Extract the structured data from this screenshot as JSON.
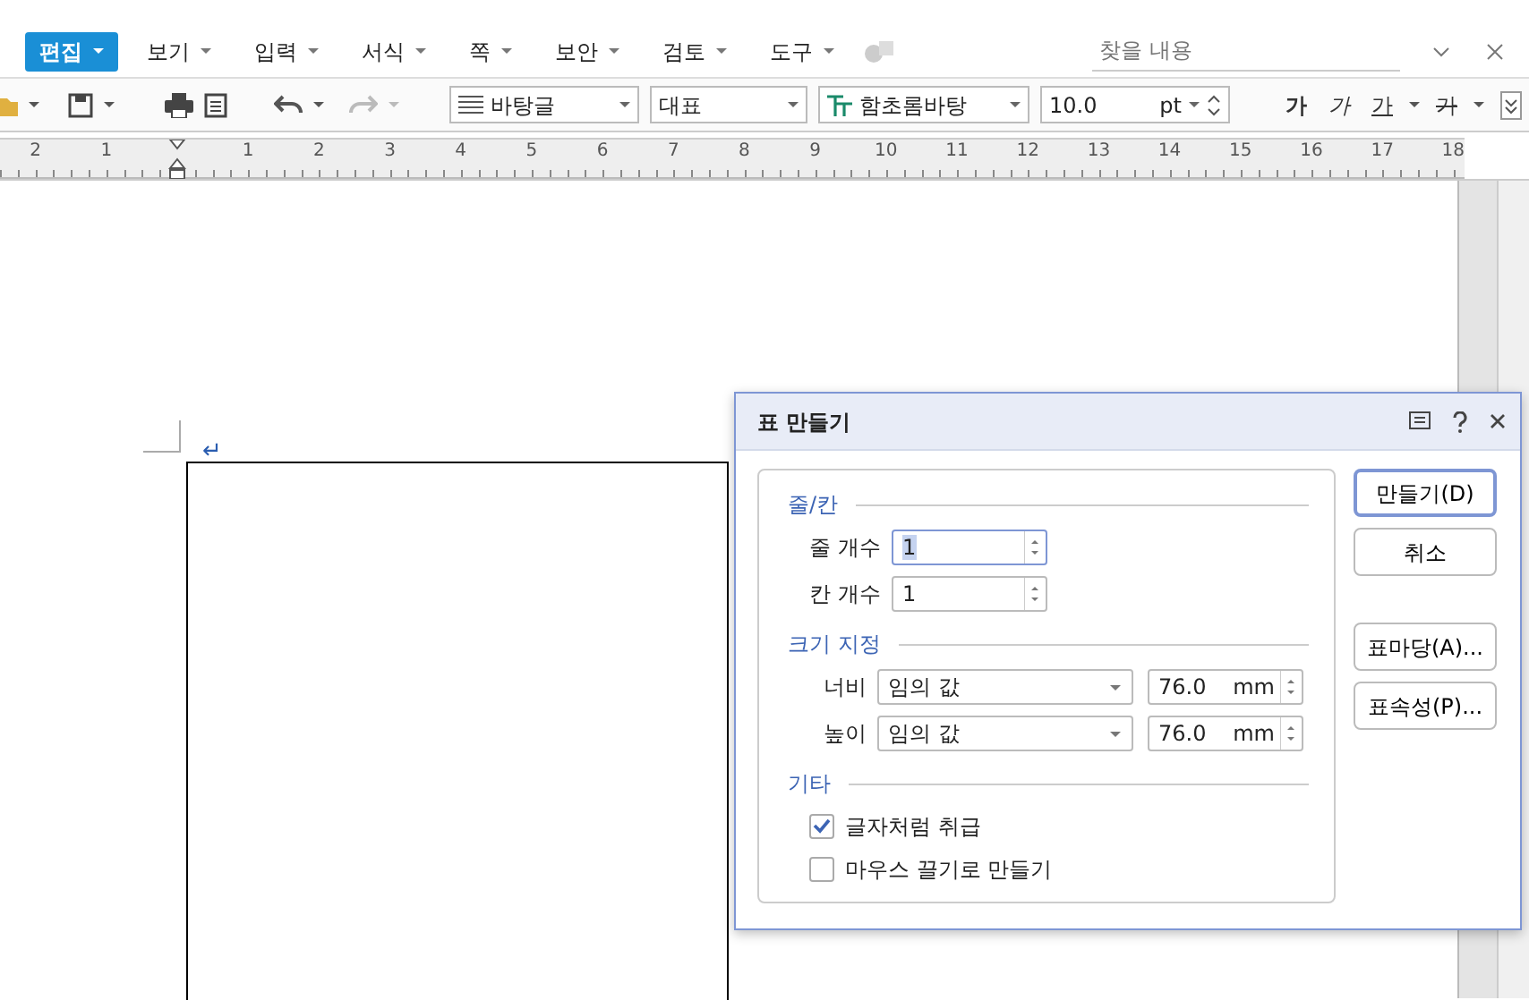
{
  "menu": [
    {
      "label": "편집",
      "selected": true
    },
    {
      "label": "보기",
      "selected": false
    },
    {
      "label": "입력",
      "selected": false
    },
    {
      "label": "서식",
      "selected": false
    },
    {
      "label": "쪽",
      "selected": false
    },
    {
      "label": "보안",
      "selected": false
    },
    {
      "label": "검토",
      "selected": false
    },
    {
      "label": "도구",
      "selected": false
    }
  ],
  "search": {
    "placeholder": "찾을 내용"
  },
  "toolbar": {
    "style": "바탕글",
    "language": "대표",
    "font": "함초롬바탕",
    "size": "10.0",
    "unit": "pt",
    "format_buttons": [
      {
        "label": "가",
        "kind": "bold"
      },
      {
        "label": "가",
        "kind": "italic"
      },
      {
        "label": "가",
        "kind": "underline"
      },
      {
        "label": "가",
        "kind": "strike"
      }
    ]
  },
  "ruler": {
    "labels": [
      "2",
      "1",
      "1",
      "2",
      "3",
      "4",
      "5",
      "6",
      "7",
      "8",
      "9",
      "10",
      "11",
      "12",
      "13",
      "14",
      "15",
      "16",
      "17",
      "18"
    ]
  },
  "document": {
    "paragraph_mark": "↵"
  },
  "dialog": {
    "title": "표 만들기",
    "sections": [
      {
        "kind": "counts",
        "title": "줄/칸",
        "rows": [
          {
            "label": "줄 개수",
            "value": "1",
            "selected": true
          },
          {
            "label": "칸 개수",
            "value": "1",
            "selected": false
          }
        ]
      },
      {
        "kind": "size",
        "title": "크기 지정",
        "rows": [
          {
            "label": "너비",
            "mode": "임의 값",
            "value": "76.0",
            "unit": "mm"
          },
          {
            "label": "높이",
            "mode": "임의 값",
            "value": "76.0",
            "unit": "mm"
          }
        ]
      },
      {
        "kind": "options",
        "title": "기타",
        "rows": [
          {
            "label": "글자처럼 취급",
            "checked": true
          },
          {
            "label": "마우스 끌기로 만들기",
            "checked": false
          }
        ]
      }
    ],
    "buttons": [
      {
        "label": "만들기(D)",
        "default": true
      },
      {
        "label": "취소",
        "default": false
      },
      {
        "label": "표마당(A)...",
        "default": false
      },
      {
        "label": "표속성(P)...",
        "default": false
      }
    ]
  }
}
